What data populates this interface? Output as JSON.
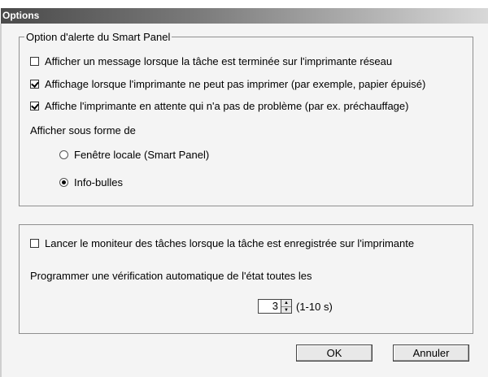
{
  "window": {
    "title": "Options"
  },
  "alert_group": {
    "legend": "Option d'alerte du Smart Panel",
    "checkboxes": [
      {
        "label": "Afficher un message lorsque la tâche est terminée sur l'imprimante réseau",
        "checked": false
      },
      {
        "label": "Affichage lorsque l'imprimante ne peut pas imprimer (par exemple, papier épuisé)",
        "checked": true
      },
      {
        "label": "Affiche l'imprimante en attente qui n'a pas de problème (par ex. préchauffage)",
        "checked": true
      }
    ],
    "display_as_label": "Afficher sous forme de",
    "radios": [
      {
        "label": "Fenêtre locale (Smart Panel)",
        "selected": false
      },
      {
        "label": "Info-bulles",
        "selected": true
      }
    ]
  },
  "monitor_group": {
    "checkbox": {
      "label": "Lancer le moniteur des tâches lorsque la tâche est enregistrée sur l'imprimante",
      "checked": false
    },
    "schedule_label": "Programmer une vérification automatique de l'état toutes les",
    "interval": {
      "value": "3",
      "range": "(1-10 s)"
    }
  },
  "buttons": {
    "ok": "OK",
    "cancel": "Annuler"
  },
  "icons": {
    "spin_up": "spin-up-arrow-icon",
    "spin_down": "spin-down-arrow-icon"
  }
}
